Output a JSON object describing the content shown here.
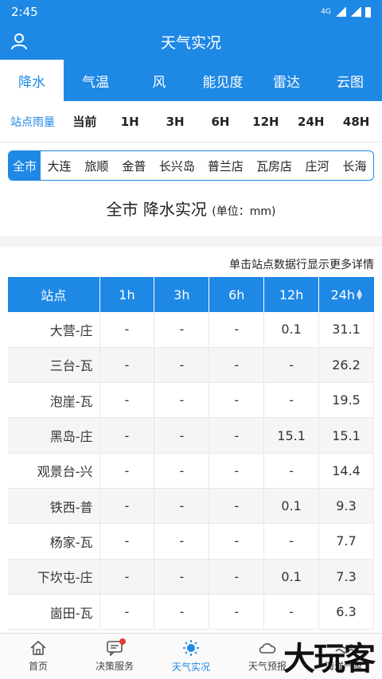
{
  "status": {
    "time": "2:45",
    "network": "4G"
  },
  "header": {
    "title": "天气实况"
  },
  "main_tabs": [
    {
      "label": "降水",
      "active": true
    },
    {
      "label": "气温"
    },
    {
      "label": "风"
    },
    {
      "label": "能见度"
    },
    {
      "label": "雷达"
    },
    {
      "label": "云图"
    }
  ],
  "sub_tabs": [
    "站点雨量",
    "当前",
    "1H",
    "3H",
    "6H",
    "12H",
    "24H",
    "48H"
  ],
  "regions": [
    "全市",
    "大连",
    "旅顺",
    "金普",
    "长兴岛",
    "普兰店",
    "瓦房店",
    "庄河",
    "长海"
  ],
  "page_title": {
    "main": "全市 降水实况",
    "unit": "(单位：mm)"
  },
  "hint": "单击站点数据行显示更多详情",
  "table": {
    "headers": [
      "站点",
      "1h",
      "3h",
      "6h",
      "12h",
      "24h"
    ],
    "rows": [
      [
        "大营-庄",
        "-",
        "-",
        "-",
        "0.1",
        "31.1"
      ],
      [
        "三台-瓦",
        "-",
        "-",
        "-",
        "-",
        "26.2"
      ],
      [
        "泡崖-瓦",
        "-",
        "-",
        "-",
        "-",
        "19.5"
      ],
      [
        "黑岛-庄",
        "-",
        "-",
        "-",
        "15.1",
        "15.1"
      ],
      [
        "观景台-兴",
        "-",
        "-",
        "-",
        "-",
        "14.4"
      ],
      [
        "铁西-普",
        "-",
        "-",
        "-",
        "0.1",
        "9.3"
      ],
      [
        "杨家-瓦",
        "-",
        "-",
        "-",
        "-",
        "7.7"
      ],
      [
        "下坎屯-庄",
        "-",
        "-",
        "-",
        "0.1",
        "7.3"
      ],
      [
        "崮田-瓦",
        "-",
        "-",
        "-",
        "-",
        "6.3"
      ]
    ]
  },
  "bottom_nav": [
    {
      "label": "首页",
      "icon": "home-icon"
    },
    {
      "label": "决策服务",
      "icon": "message-icon"
    },
    {
      "label": "天气实况",
      "icon": "sun-icon",
      "active": true
    },
    {
      "label": "天气预报",
      "icon": "cloud-icon"
    },
    {
      "label": "海洋气象",
      "icon": "wave-icon"
    }
  ],
  "watermark": "大玩客",
  "colors": {
    "primary": "#1e88e5",
    "badge": "#e53935"
  }
}
